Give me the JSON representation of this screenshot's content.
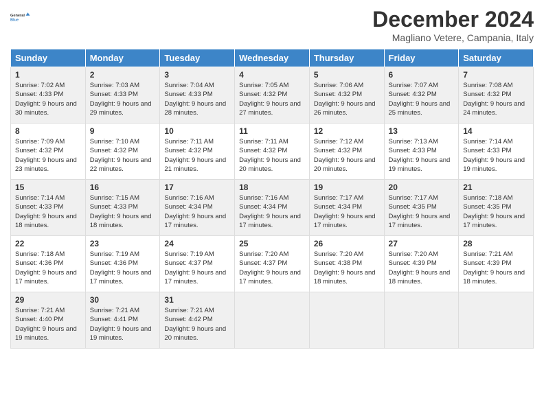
{
  "logo": {
    "line1": "General",
    "line2": "Blue"
  },
  "title": "December 2024",
  "subtitle": "Magliano Vetere, Campania, Italy",
  "days_of_week": [
    "Sunday",
    "Monday",
    "Tuesday",
    "Wednesday",
    "Thursday",
    "Friday",
    "Saturday"
  ],
  "weeks": [
    [
      {
        "day": "1",
        "sunrise": "7:02 AM",
        "sunset": "4:33 PM",
        "daylight": "9 hours and 30 minutes."
      },
      {
        "day": "2",
        "sunrise": "7:03 AM",
        "sunset": "4:33 PM",
        "daylight": "9 hours and 29 minutes."
      },
      {
        "day": "3",
        "sunrise": "7:04 AM",
        "sunset": "4:33 PM",
        "daylight": "9 hours and 28 minutes."
      },
      {
        "day": "4",
        "sunrise": "7:05 AM",
        "sunset": "4:32 PM",
        "daylight": "9 hours and 27 minutes."
      },
      {
        "day": "5",
        "sunrise": "7:06 AM",
        "sunset": "4:32 PM",
        "daylight": "9 hours and 26 minutes."
      },
      {
        "day": "6",
        "sunrise": "7:07 AM",
        "sunset": "4:32 PM",
        "daylight": "9 hours and 25 minutes."
      },
      {
        "day": "7",
        "sunrise": "7:08 AM",
        "sunset": "4:32 PM",
        "daylight": "9 hours and 24 minutes."
      }
    ],
    [
      {
        "day": "8",
        "sunrise": "7:09 AM",
        "sunset": "4:32 PM",
        "daylight": "9 hours and 23 minutes."
      },
      {
        "day": "9",
        "sunrise": "7:10 AM",
        "sunset": "4:32 PM",
        "daylight": "9 hours and 22 minutes."
      },
      {
        "day": "10",
        "sunrise": "7:11 AM",
        "sunset": "4:32 PM",
        "daylight": "9 hours and 21 minutes."
      },
      {
        "day": "11",
        "sunrise": "7:11 AM",
        "sunset": "4:32 PM",
        "daylight": "9 hours and 20 minutes."
      },
      {
        "day": "12",
        "sunrise": "7:12 AM",
        "sunset": "4:32 PM",
        "daylight": "9 hours and 20 minutes."
      },
      {
        "day": "13",
        "sunrise": "7:13 AM",
        "sunset": "4:33 PM",
        "daylight": "9 hours and 19 minutes."
      },
      {
        "day": "14",
        "sunrise": "7:14 AM",
        "sunset": "4:33 PM",
        "daylight": "9 hours and 19 minutes."
      }
    ],
    [
      {
        "day": "15",
        "sunrise": "7:14 AM",
        "sunset": "4:33 PM",
        "daylight": "9 hours and 18 minutes."
      },
      {
        "day": "16",
        "sunrise": "7:15 AM",
        "sunset": "4:33 PM",
        "daylight": "9 hours and 18 minutes."
      },
      {
        "day": "17",
        "sunrise": "7:16 AM",
        "sunset": "4:34 PM",
        "daylight": "9 hours and 17 minutes."
      },
      {
        "day": "18",
        "sunrise": "7:16 AM",
        "sunset": "4:34 PM",
        "daylight": "9 hours and 17 minutes."
      },
      {
        "day": "19",
        "sunrise": "7:17 AM",
        "sunset": "4:34 PM",
        "daylight": "9 hours and 17 minutes."
      },
      {
        "day": "20",
        "sunrise": "7:17 AM",
        "sunset": "4:35 PM",
        "daylight": "9 hours and 17 minutes."
      },
      {
        "day": "21",
        "sunrise": "7:18 AM",
        "sunset": "4:35 PM",
        "daylight": "9 hours and 17 minutes."
      }
    ],
    [
      {
        "day": "22",
        "sunrise": "7:18 AM",
        "sunset": "4:36 PM",
        "daylight": "9 hours and 17 minutes."
      },
      {
        "day": "23",
        "sunrise": "7:19 AM",
        "sunset": "4:36 PM",
        "daylight": "9 hours and 17 minutes."
      },
      {
        "day": "24",
        "sunrise": "7:19 AM",
        "sunset": "4:37 PM",
        "daylight": "9 hours and 17 minutes."
      },
      {
        "day": "25",
        "sunrise": "7:20 AM",
        "sunset": "4:37 PM",
        "daylight": "9 hours and 17 minutes."
      },
      {
        "day": "26",
        "sunrise": "7:20 AM",
        "sunset": "4:38 PM",
        "daylight": "9 hours and 18 minutes."
      },
      {
        "day": "27",
        "sunrise": "7:20 AM",
        "sunset": "4:39 PM",
        "daylight": "9 hours and 18 minutes."
      },
      {
        "day": "28",
        "sunrise": "7:21 AM",
        "sunset": "4:39 PM",
        "daylight": "9 hours and 18 minutes."
      }
    ],
    [
      {
        "day": "29",
        "sunrise": "7:21 AM",
        "sunset": "4:40 PM",
        "daylight": "9 hours and 19 minutes."
      },
      {
        "day": "30",
        "sunrise": "7:21 AM",
        "sunset": "4:41 PM",
        "daylight": "9 hours and 19 minutes."
      },
      {
        "day": "31",
        "sunrise": "7:21 AM",
        "sunset": "4:42 PM",
        "daylight": "9 hours and 20 minutes."
      },
      null,
      null,
      null,
      null
    ]
  ],
  "labels": {
    "sunrise": "Sunrise:",
    "sunset": "Sunset:",
    "daylight": "Daylight:"
  }
}
